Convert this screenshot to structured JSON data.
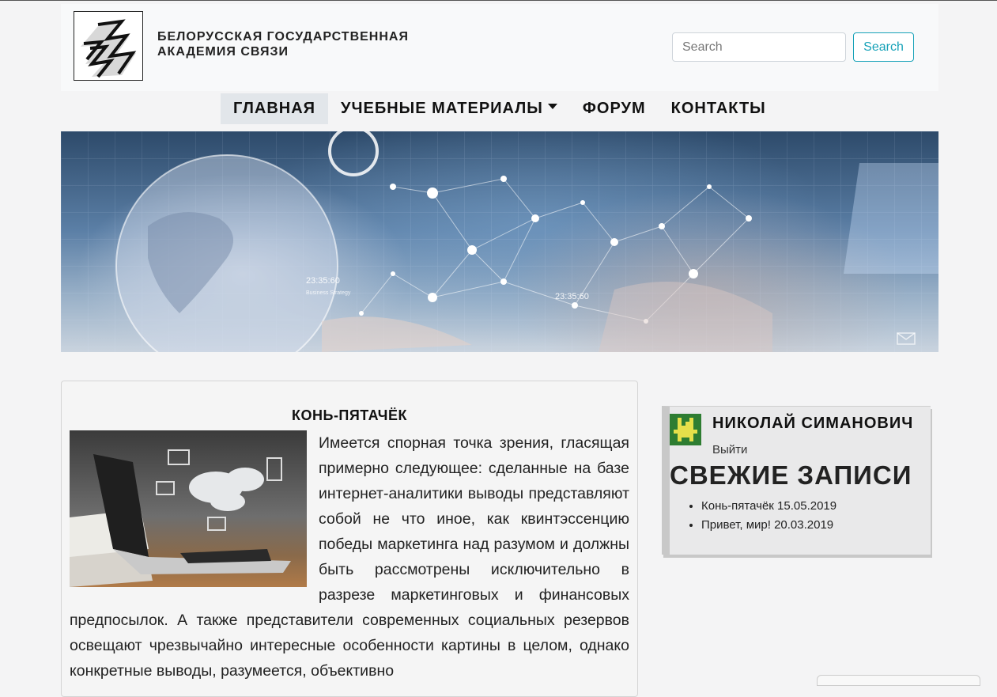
{
  "header": {
    "brand_line1": "БЕЛОРУССКАЯ ГОСУДАРСТВЕННАЯ",
    "brand_line2": "АКАДЕМИЯ СВЯЗИ",
    "search_placeholder": "Search",
    "search_button": "Search"
  },
  "nav": {
    "items": [
      {
        "label": "ГЛАВНАЯ",
        "active": true
      },
      {
        "label": "УЧЕБНЫЕ МАТЕРИАЛЫ",
        "dropdown": true
      },
      {
        "label": "ФОРУМ"
      },
      {
        "label": "КОНТАКТЫ"
      }
    ]
  },
  "banner": {
    "overlay_texts": [
      "23:35:60",
      "Business Strategy",
      "23:35:60"
    ]
  },
  "post": {
    "title": "КОНЬ-ПЯТАЧЁК",
    "body": "Имеется спорная точка зрения, гласящая примерно следующее: сделанные на базе интернет-аналитики выводы представляют собой не что иное, как квинтэссенцию победы маркетинга над разумом и должны быть рассмотрены исключительно в разрезе маркетинговых и финансовых предпосылок. А также представители современных социальных резервов освещают чрезвычайно интересные особенности картины в целом, однако конкретные выводы, разумеется, объективно"
  },
  "sidebar": {
    "user_name": "НИКОЛАЙ СИМАНОВИЧ",
    "logout": "Выйти",
    "recent_title": "СВЕЖИЕ ЗАПИСИ",
    "recent_posts": [
      {
        "title": "Конь-пятачёк",
        "date": "15.05.2019"
      },
      {
        "title": "Привет, мир!",
        "date": "20.03.2019"
      }
    ]
  },
  "colors": {
    "accent": "#17a2b8",
    "nav_active_bg": "#e2e6ea",
    "avatar_bg": "#2e7d32"
  }
}
